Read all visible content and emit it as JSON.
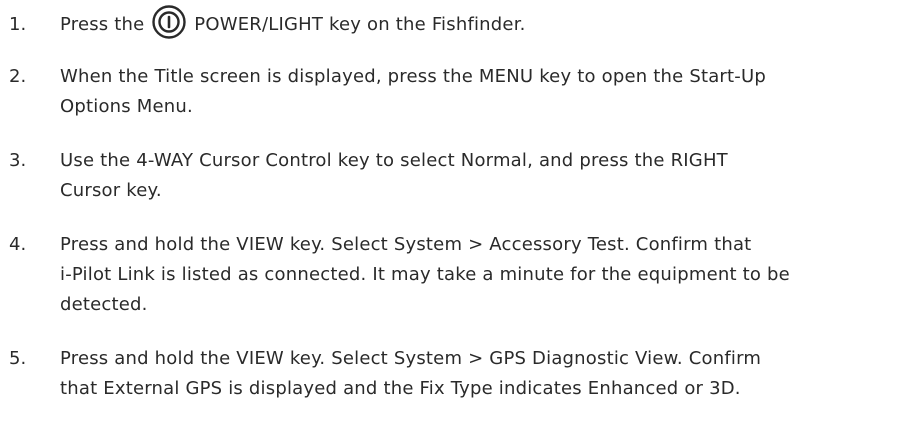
{
  "steps": [
    {
      "number": "1.",
      "text_before_icon": "Press the",
      "icon": "power-button-icon",
      "text_after_icon": "POWER/LIGHT key on the Fishfinder."
    },
    {
      "number": "2.",
      "lines": [
        "When the Title screen is displayed, press the MENU key to open the Start-Up",
        "Options Menu."
      ]
    },
    {
      "number": "3.",
      "lines": [
        "Use the 4-WAY Cursor Control key to select Normal, and press the RIGHT",
        "Cursor key."
      ]
    },
    {
      "number": "4.",
      "lines": [
        "Press and hold the VIEW key. Select System > Accessory Test. Confirm that",
        "i-Pilot Link is listed as connected. It may take a minute for the equipment to be",
        "detected."
      ]
    },
    {
      "number": "5.",
      "lines": [
        "Press and hold the VIEW key. Select System > GPS Diagnostic View. Confirm",
        "that External GPS is displayed and the Fix Type indicates Enhanced or 3D."
      ]
    }
  ]
}
